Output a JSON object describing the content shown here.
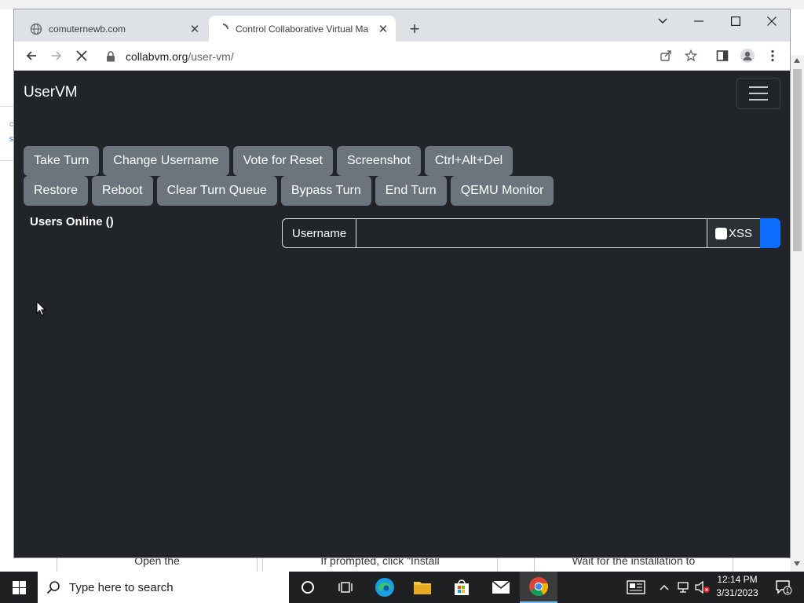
{
  "browser": {
    "tabs": [
      {
        "title": "comuternewb.com",
        "favicon": "globe-icon"
      },
      {
        "title": "Control Collaborative Virtual Ma",
        "favicon": "loading-spinner-icon"
      }
    ],
    "url_host": "collabvm.org",
    "url_path": "/user-vm/"
  },
  "page": {
    "brand": "UserVM",
    "buttons_row1": [
      "Take Turn",
      "Change Username",
      "Vote for Reset",
      "Screenshot",
      "Ctrl+Alt+Del"
    ],
    "buttons_row2": [
      "Restore",
      "Reboot",
      "Clear Turn Queue",
      "Bypass Turn",
      "End Turn",
      "QEMU Monitor"
    ],
    "users_online": "Users Online ()",
    "chat": {
      "username_label": "Username",
      "input_value": "",
      "xss_label": "XSS"
    },
    "colors": {
      "background": "#212529",
      "button": "#6c757d",
      "send": "#0d6efd"
    }
  },
  "background_page": {
    "steps": [
      "Open the",
      "If prompted, click \"Install",
      "Wait for the installation to"
    ],
    "left_chars": [
      "c",
      "s"
    ]
  },
  "taskbar": {
    "search_placeholder": "Type here to search",
    "time": "12:14 PM",
    "date": "3/31/2023",
    "notification_count": "1"
  }
}
